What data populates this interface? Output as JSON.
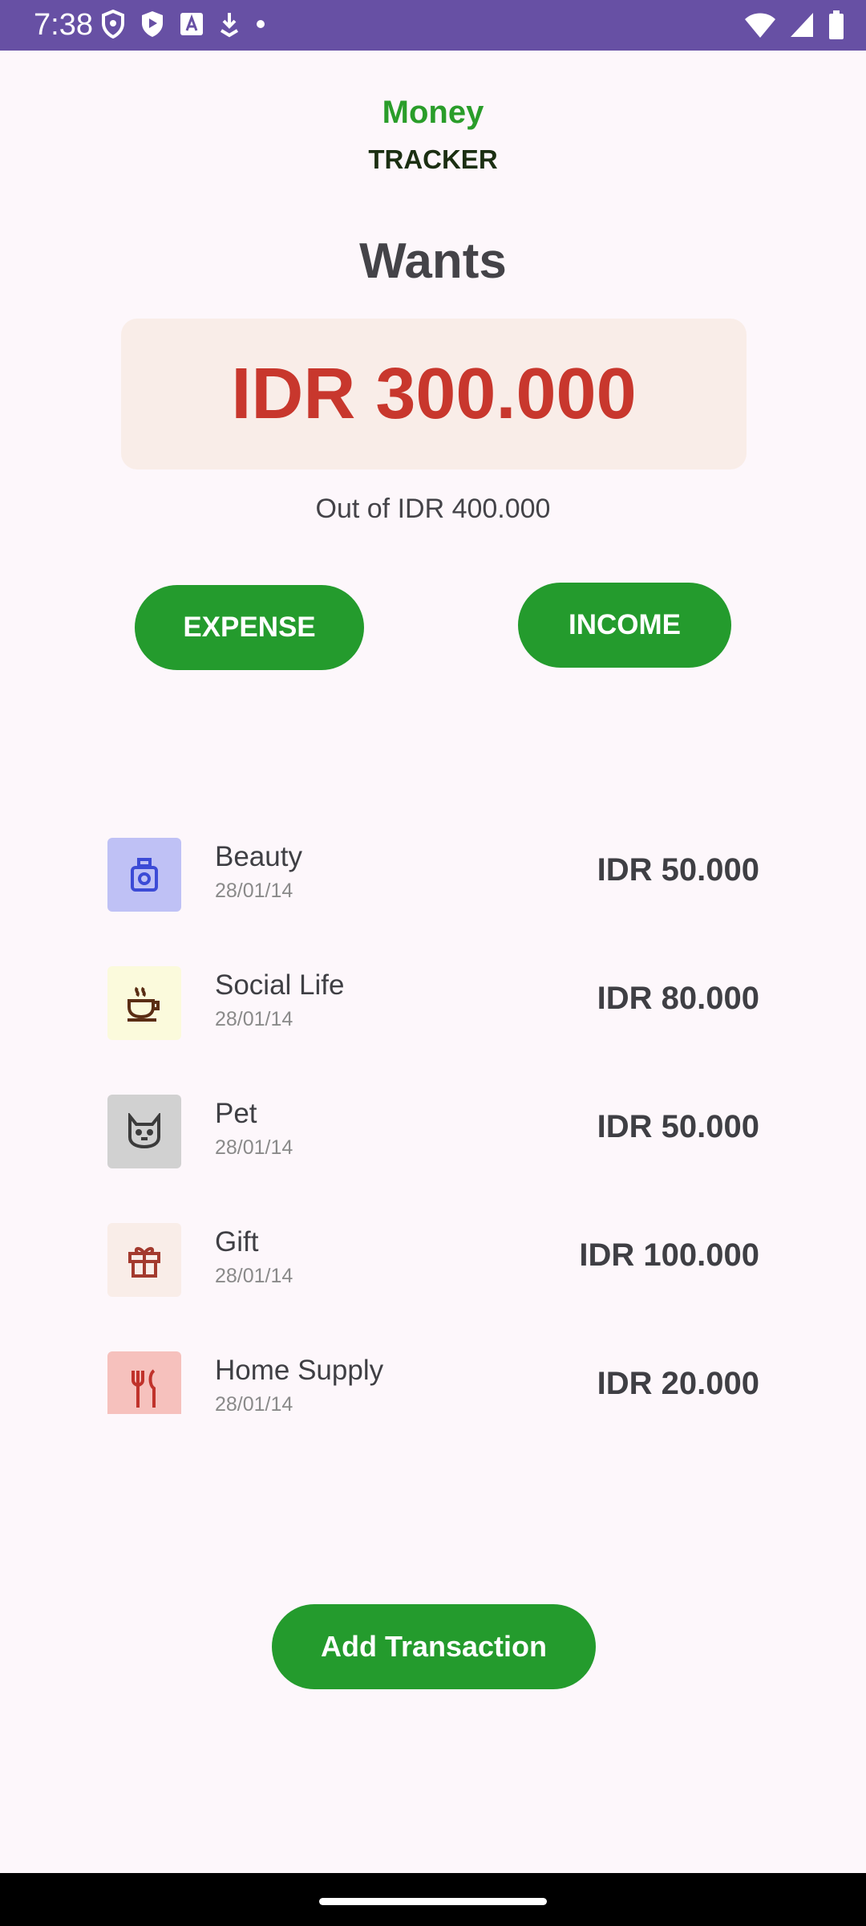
{
  "status_bar": {
    "time": "7:38",
    "left_icons": [
      "shield-icon",
      "play-protect-icon",
      "font-a-icon",
      "download-icon",
      "dot-icon"
    ],
    "right_icons": [
      "wifi-icon",
      "signal-icon",
      "battery-icon"
    ],
    "color": "#6750a4"
  },
  "header": {
    "title_line1": "Money",
    "title_line2": "TRACKER"
  },
  "category": {
    "title": "Wants",
    "amount": "IDR 300.000",
    "limit": "Out of IDR 400.000"
  },
  "buttons": {
    "expense": "EXPENSE",
    "income": "INCOME",
    "add_transaction": "Add Transaction"
  },
  "transactions": [
    {
      "name": "Beauty",
      "date": "28/01/14",
      "amount": "IDR 50.000",
      "icon": "perfume-icon",
      "icon_bg": "#bfc1f5",
      "icon_color": "#3c4bd6"
    },
    {
      "name": "Social Life",
      "date": "28/01/14",
      "amount": "IDR 80.000",
      "icon": "coffee-cup-icon",
      "icon_bg": "#fbfadc",
      "icon_color": "#5a2d14"
    },
    {
      "name": "Pet",
      "date": "28/01/14",
      "amount": "IDR 50.000",
      "icon": "cat-icon",
      "icon_bg": "#d1d1d1",
      "icon_color": "#3b3b3b"
    },
    {
      "name": "Gift",
      "date": "28/01/14",
      "amount": "IDR 100.000",
      "icon": "gift-icon",
      "icon_bg": "#f9ede8",
      "icon_color": "#a33a2e"
    },
    {
      "name": "Home Supply",
      "date": "28/01/14",
      "amount": "IDR 20.000",
      "icon": "fork-knife-icon",
      "icon_bg": "#f6c1bd",
      "icon_color": "#c0322b"
    }
  ],
  "colors": {
    "accent_green": "#249b2d",
    "amount_red": "#c8372d",
    "card_bg": "#f9ede8"
  }
}
